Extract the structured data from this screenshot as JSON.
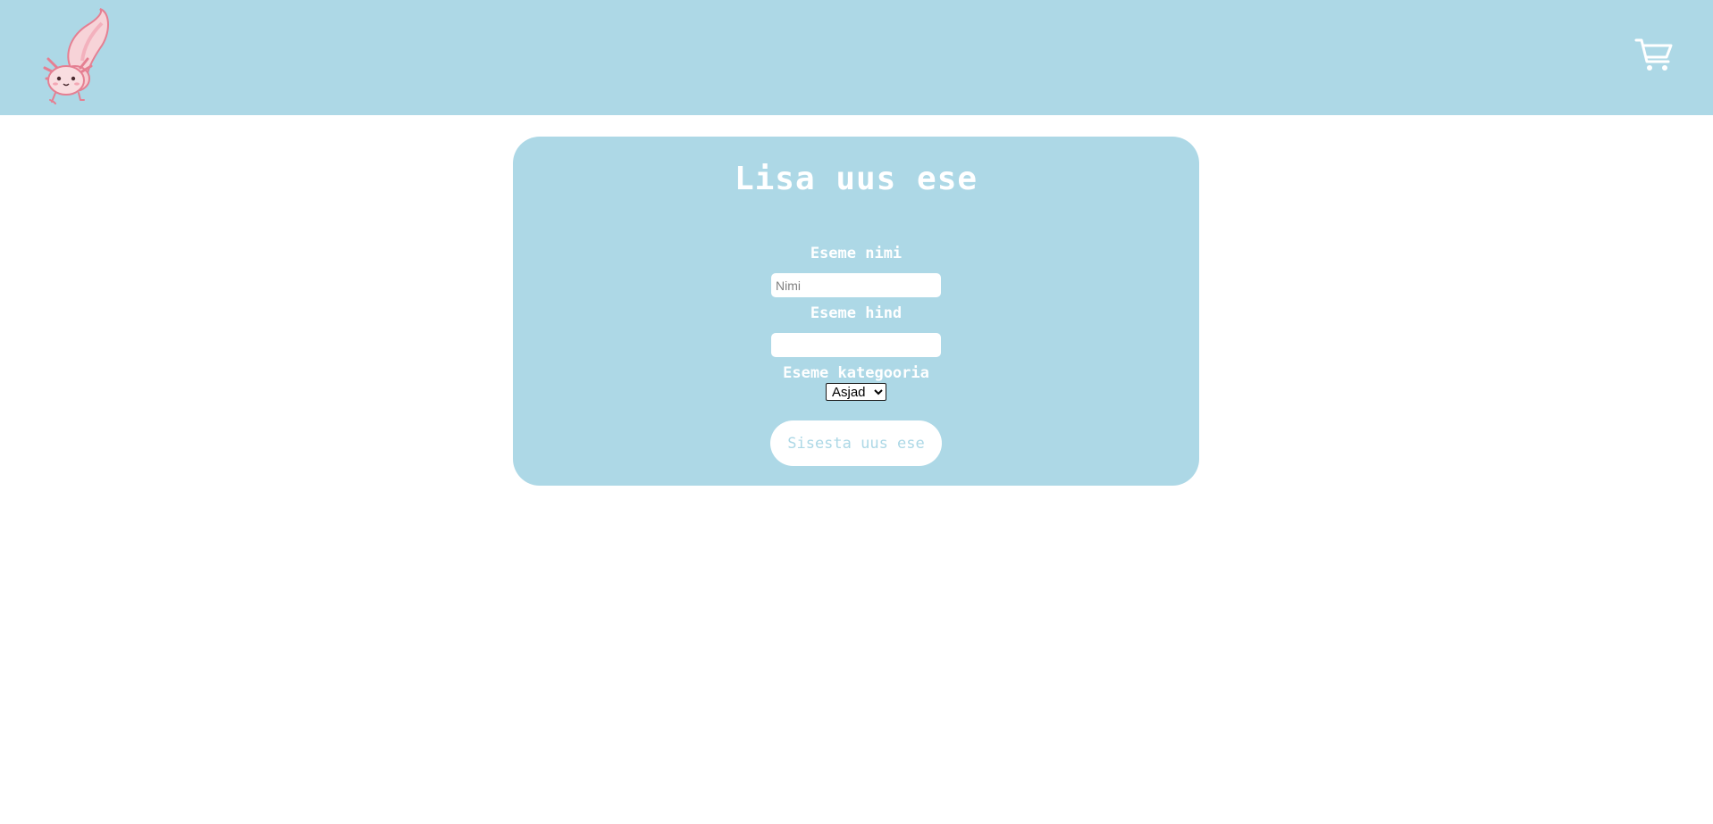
{
  "header": {
    "logo_icon": "axolotl-logo",
    "cart_icon": "shopping-cart-icon",
    "background_color": "#add8e6"
  },
  "form": {
    "title": "Lisa uus ese",
    "name_label": "Eseme nimi",
    "name_value": "",
    "name_placeholder": "Nimi",
    "price_label": "Eseme hind",
    "price_value": "",
    "price_placeholder": "",
    "category_label": "Eseme kategooria",
    "category_selected": "Asjad",
    "submit_label": "Sisesta uus ese",
    "background_color": "#add8e6"
  }
}
